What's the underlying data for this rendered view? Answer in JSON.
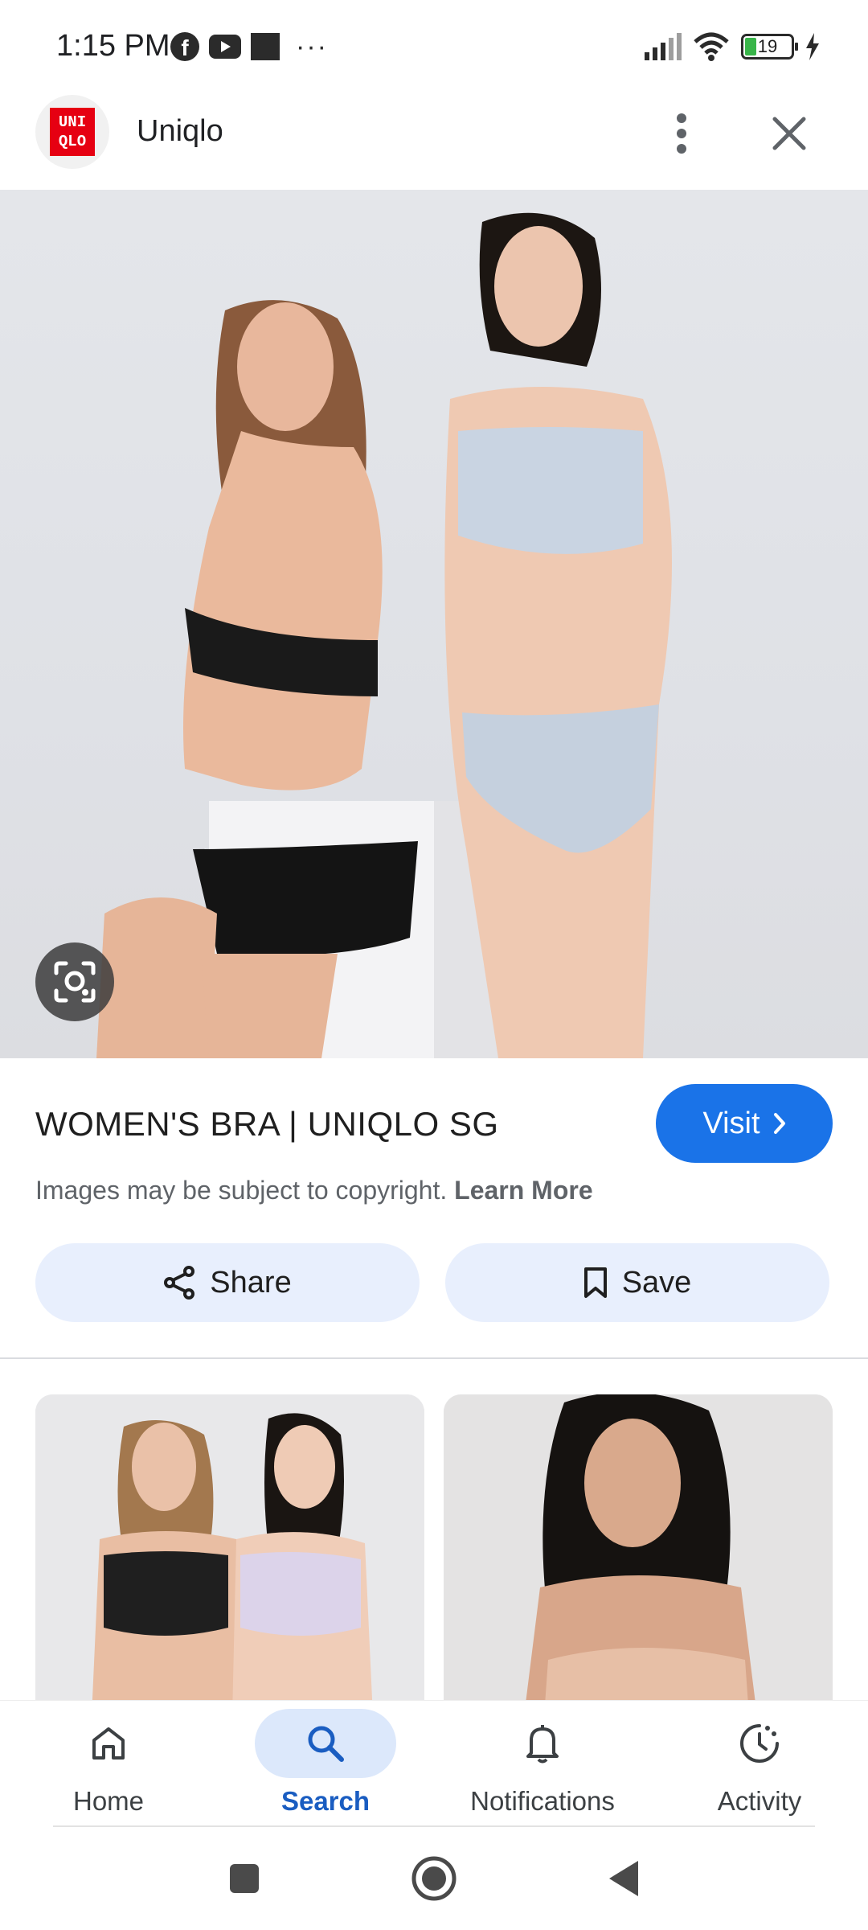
{
  "status_bar": {
    "time": "1:15 PM",
    "battery_level": "19",
    "icons": [
      "facebook-icon",
      "youtube-icon",
      "square-icon",
      "more-dots-icon",
      "signal-icon",
      "wifi-icon",
      "battery-icon",
      "charging-icon"
    ]
  },
  "header": {
    "logo_text": "UNI\nQLO",
    "site_name": "Uniqlo",
    "icons": [
      "more-vert-icon",
      "close-icon"
    ]
  },
  "result": {
    "title": "WOMEN'S BRA | UNIQLO SG",
    "visit_label": "Visit",
    "copyright_text": "Images may be subject to copyright.",
    "learn_more": "Learn More",
    "share_label": "Share",
    "save_label": "Save"
  },
  "bottom_nav": {
    "items": [
      {
        "label": "Home",
        "icon": "home-icon"
      },
      {
        "label": "Search",
        "icon": "search-icon"
      },
      {
        "label": "Notifications",
        "icon": "bell-icon"
      },
      {
        "label": "Activity",
        "icon": "activity-icon"
      }
    ],
    "selected": "Search"
  },
  "system_nav": [
    "recent-apps-button",
    "home-button",
    "back-button"
  ],
  "colors": {
    "accent": "#1a73e8",
    "chip_background": "#e8effd",
    "nav_selected_background": "#dce8fb",
    "brand_red": "#e60012"
  }
}
